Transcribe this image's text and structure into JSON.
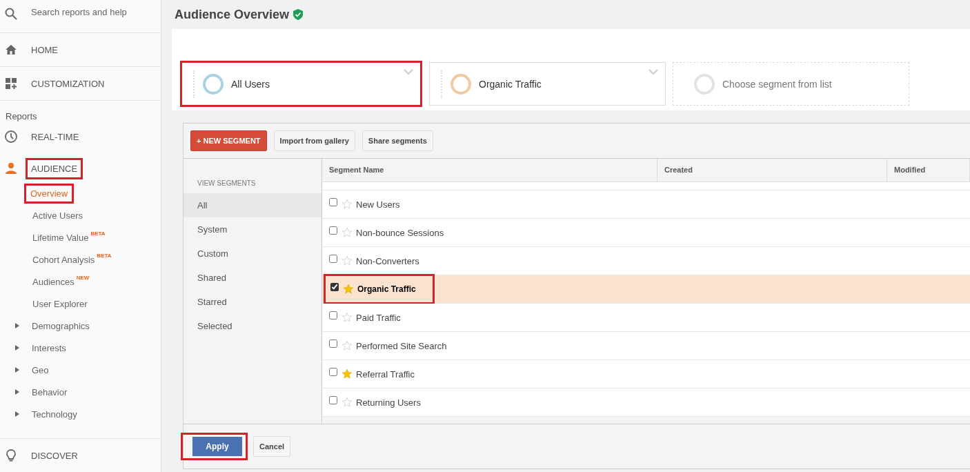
{
  "sidebar": {
    "search": {
      "placeholder": "Search reports and help"
    },
    "top_items": [
      {
        "label": "HOME"
      },
      {
        "label": "CUSTOMIZATION"
      }
    ],
    "reports_heading": "Reports",
    "realtime": {
      "label": "REAL-TIME"
    },
    "audience": {
      "label": "AUDIENCE",
      "highlighted": true,
      "children": [
        {
          "label": "Overview",
          "selected": true,
          "highlighted": true,
          "kind": "link"
        },
        {
          "label": "Active Users",
          "selected": false,
          "highlighted": false,
          "kind": "link"
        },
        {
          "label": "Lifetime Value",
          "badge": "BETA",
          "selected": false,
          "highlighted": false,
          "kind": "link"
        },
        {
          "label": "Cohort Analysis",
          "badge": "BETA",
          "selected": false,
          "highlighted": false,
          "kind": "link"
        },
        {
          "label": "Audiences",
          "badge": "NEW",
          "selected": false,
          "highlighted": false,
          "kind": "link"
        },
        {
          "label": "User Explorer",
          "selected": false,
          "highlighted": false,
          "kind": "link"
        },
        {
          "label": "Demographics",
          "selected": false,
          "highlighted": false,
          "kind": "group",
          "expanded": false
        },
        {
          "label": "Interests",
          "selected": false,
          "highlighted": false,
          "kind": "group",
          "expanded": false
        },
        {
          "label": "Geo",
          "selected": false,
          "highlighted": false,
          "kind": "group",
          "expanded": false
        },
        {
          "label": "Behavior",
          "selected": false,
          "highlighted": false,
          "kind": "group",
          "expanded": false
        },
        {
          "label": "Technology",
          "selected": false,
          "highlighted": false,
          "kind": "group",
          "expanded": false
        }
      ]
    },
    "discover": {
      "label": "DISCOVER"
    }
  },
  "page_title": "Audience Overview",
  "segments": [
    {
      "kind": "segment",
      "label": "All Users",
      "color": "#a9d2e2",
      "highlighted": true
    },
    {
      "kind": "segment",
      "label": "Organic Traffic",
      "color": "#f1c9a0",
      "highlighted": false
    },
    {
      "kind": "placeholder",
      "label": "Choose segment from list",
      "color": "#e2e2e2",
      "highlighted": false
    }
  ],
  "toolbar": {
    "new_segment": "+ NEW SEGMENT",
    "import": "Import from gallery",
    "share": "Share segments"
  },
  "view_segments": {
    "heading": "VIEW SEGMENTS",
    "items": [
      {
        "label": "All",
        "selected": true
      },
      {
        "label": "System",
        "selected": false
      },
      {
        "label": "Custom",
        "selected": false
      },
      {
        "label": "Shared",
        "selected": false
      },
      {
        "label": "Starred",
        "selected": false
      },
      {
        "label": "Selected",
        "selected": false
      }
    ]
  },
  "table": {
    "columns": [
      "Segment Name",
      "Created",
      "Modified"
    ],
    "rows": [
      {
        "name": "New Users",
        "checked": false,
        "starred": false,
        "highlighted": false
      },
      {
        "name": "Non-bounce Sessions",
        "checked": false,
        "starred": false,
        "highlighted": false
      },
      {
        "name": "Non-Converters",
        "checked": false,
        "starred": false,
        "highlighted": false
      },
      {
        "name": "Organic Traffic",
        "checked": true,
        "starred": true,
        "highlighted": true
      },
      {
        "name": "Paid Traffic",
        "checked": false,
        "starred": false,
        "highlighted": false
      },
      {
        "name": "Performed Site Search",
        "checked": false,
        "starred": false,
        "highlighted": false
      },
      {
        "name": "Referral Traffic",
        "checked": false,
        "starred": true,
        "highlighted": false
      },
      {
        "name": "Returning Users",
        "checked": false,
        "starred": false,
        "highlighted": false
      }
    ]
  },
  "footer": {
    "apply": {
      "label": "Apply",
      "highlighted": true
    },
    "cancel": "Cancel"
  }
}
